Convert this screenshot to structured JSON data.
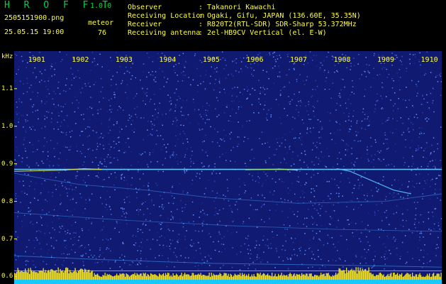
{
  "app": {
    "name": "H R O F F T",
    "version": "1.0.0"
  },
  "file": {
    "name": "2505151900.png",
    "timestamp": "25.05.15 19:00"
  },
  "meteor": {
    "label": "meteor",
    "count": "76"
  },
  "info": [
    {
      "label": "Observer",
      "value": ": Takanori Kawachi"
    },
    {
      "label": "Receiving Location",
      "value": ": Ogaki, Gifu, JAPAN (136.60E, 35.35N)"
    },
    {
      "label": "Receiver",
      "value": ": R820T2(RTL-SDR) SDR-Sharp 53.372MHz"
    },
    {
      "label": "Receiving antenna",
      "value": ": 2el-HB9CV Vertical (el. E-W)"
    }
  ],
  "axis": {
    "unit": "kHz",
    "y_ticks": [
      "1.1",
      "1.0",
      "0.9",
      "0.8",
      "0.7",
      "0.6"
    ],
    "y_values": [
      1.1,
      1.0,
      0.9,
      0.8,
      0.7,
      0.6
    ],
    "y_range": [
      0.58,
      1.2
    ],
    "x_ticks": [
      "1901",
      "1902",
      "1903",
      "1904",
      "1905",
      "1906",
      "1907",
      "1908",
      "1909",
      "1910"
    ],
    "x_range": [
      1900.5,
      1910.3
    ]
  },
  "colors": {
    "background": "#101a70",
    "trace": "#5ac8ff",
    "header_text": "#ffff40",
    "title": "#00d050"
  }
}
